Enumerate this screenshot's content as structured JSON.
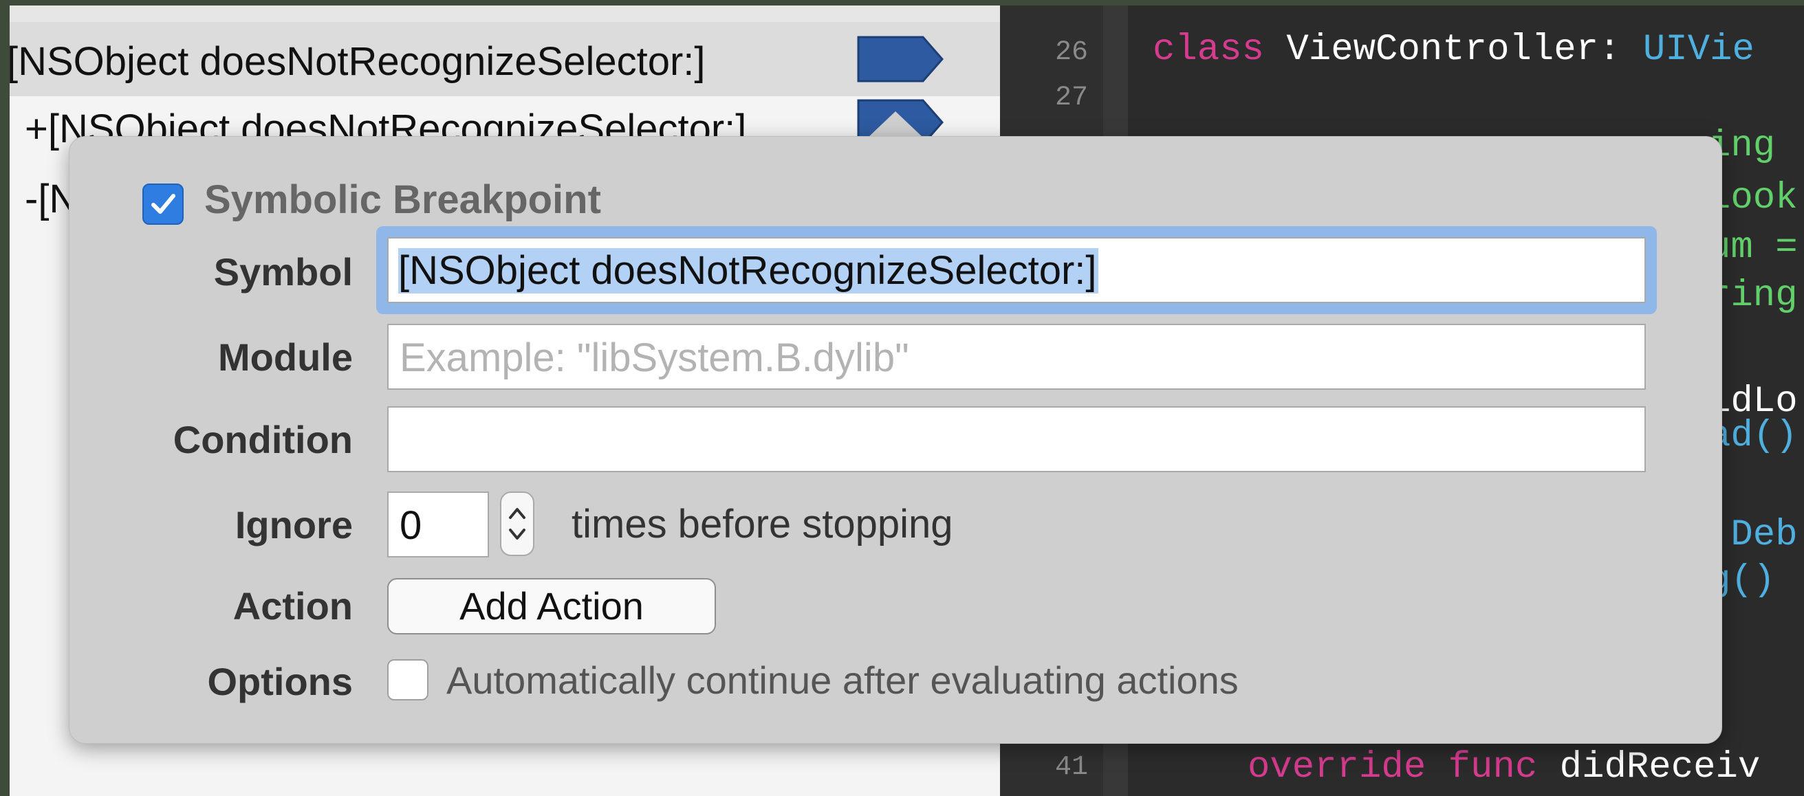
{
  "colors": {
    "accent_blue": "#2f7de0",
    "selection_blue": "#b3d0f5",
    "breakpoint_blue": "#2d5aa0",
    "editor_bg": "#2b2b2b",
    "keyword_pink": "#d53b8e",
    "type_blue": "#4fb0e0"
  },
  "navigator": {
    "items": [
      {
        "label": "[NSObject doesNotRecognizeSelector:]",
        "selected": true,
        "icon": "breakpoint-flag-icon"
      },
      {
        "label": "+[NSObject doesNotRecognizeSelector:]",
        "icon": "breakpoint-flag-icon"
      },
      {
        "label": "-[N"
      }
    ]
  },
  "editor": {
    "lines": [
      {
        "num": "26",
        "keyword": "class",
        "text": " ViewController: ",
        "type": "UIVie"
      },
      {
        "num": "27",
        "text": ""
      },
      {
        "num": "41",
        "keyword": "override func",
        "text": " didReceiv"
      }
    ],
    "right_fragments": [
      "ing ",
      "look",
      "um =",
      "ring",
      "idLo",
      "ad()",
      ":Deb",
      "g()"
    ]
  },
  "popover": {
    "enabled": true,
    "title": "Symbolic Breakpoint",
    "symbol": {
      "label": "Symbol",
      "value": "[NSObject doesNotRecognizeSelector:]"
    },
    "module": {
      "label": "Module",
      "placeholder": "Example: \"libSystem.B.dylib\""
    },
    "condition": {
      "label": "Condition",
      "value": ""
    },
    "ignore": {
      "label": "Ignore",
      "value": "0",
      "suffix": "times before stopping"
    },
    "action": {
      "label": "Action",
      "button": "Add Action"
    },
    "options": {
      "label": "Options",
      "checked": false,
      "text": "Automatically continue after evaluating actions"
    }
  }
}
